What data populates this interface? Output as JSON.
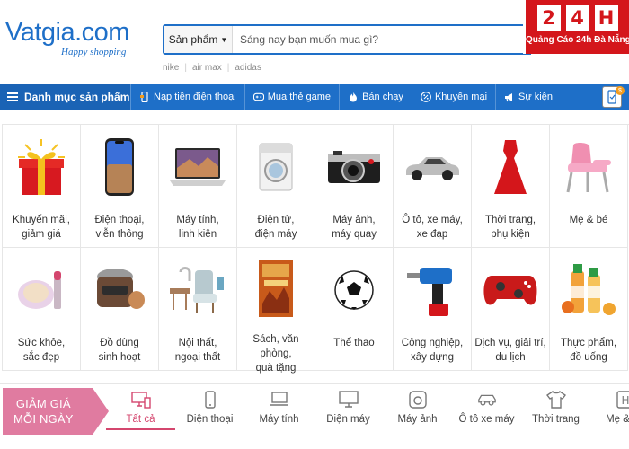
{
  "logo": {
    "name": "Vatgia.com",
    "tagline": "Happy shopping"
  },
  "search": {
    "category": "Sản phẩm",
    "placeholder": "Sáng nay bạn muốn mua gì?"
  },
  "suggest_tags": [
    "nike",
    "air max",
    "adidas"
  ],
  "promo": {
    "boxes": [
      "2",
      "4",
      "H"
    ],
    "text": "Quảng Cáo 24h Đà Nẵng"
  },
  "navbar": {
    "main": "Danh mục sản phẩm",
    "items": [
      {
        "label": "Nạp tiền điện thoại",
        "icon": "phone-topup-icon"
      },
      {
        "label": "Mua thẻ game",
        "icon": "gamepad-icon"
      },
      {
        "label": "Bán chạy",
        "icon": "flame-icon"
      },
      {
        "label": "Khuyến mại",
        "icon": "discount-icon"
      },
      {
        "label": "Sự kiện",
        "icon": "megaphone-icon"
      }
    ]
  },
  "categories": [
    {
      "label": "Khuyến mãi,\ngiảm giá",
      "icon": "gift-box-icon"
    },
    {
      "label": "Điện thoại,\nviễn thông",
      "icon": "smartphone-icon"
    },
    {
      "label": "Máy tính,\nlinh kiện",
      "icon": "laptop-icon"
    },
    {
      "label": "Điện tử,\nđiện máy",
      "icon": "washing-machine-icon"
    },
    {
      "label": "Máy ảnh,\nmáy quay",
      "icon": "camera-icon"
    },
    {
      "label": "Ô tô, xe máy,\nxe đạp",
      "icon": "car-icon"
    },
    {
      "label": "Thời trang,\nphụ kiện",
      "icon": "dress-icon"
    },
    {
      "label": "Mẹ & bé",
      "icon": "baby-chair-icon"
    },
    {
      "label": "Sức khỏe,\nsắc đẹp",
      "icon": "cosmetics-icon"
    },
    {
      "label": "Đồ dùng\nsinh hoạt",
      "icon": "rice-cooker-icon"
    },
    {
      "label": "Nội thất,\nngoại thất",
      "icon": "furniture-icon"
    },
    {
      "label": "Sách, văn phòng,\nquà tặng",
      "icon": "book-icon"
    },
    {
      "label": "Thể thao",
      "icon": "football-icon"
    },
    {
      "label": "Công nghiệp,\nxây dựng",
      "icon": "drill-icon"
    },
    {
      "label": "Dịch vụ, giải trí,\ndu lịch",
      "icon": "game-controller-icon"
    },
    {
      "label": "Thực phẩm,\nđồ uống",
      "icon": "juice-bottles-icon"
    }
  ],
  "deals": {
    "title_line1": "GIẢM GIÁ",
    "title_line2": "MỖI NGÀY",
    "tabs": [
      {
        "label": "Tất cả",
        "icon": "monitor-phone-icon",
        "active": true
      },
      {
        "label": "Điện thoại",
        "icon": "smartphone-icon"
      },
      {
        "label": "Máy tính",
        "icon": "laptop-icon"
      },
      {
        "label": "Điện máy",
        "icon": "tv-icon"
      },
      {
        "label": "Máy ảnh",
        "icon": "camera-icon"
      },
      {
        "label": "Ô tô xe máy",
        "icon": "car-icon"
      },
      {
        "label": "Thời trang",
        "icon": "shirt-icon"
      },
      {
        "label": "Mẹ & bé",
        "icon": "stroller-icon"
      }
    ]
  },
  "colors": {
    "brand_blue": "#1e6fc8",
    "promo_red": "#d4161b",
    "deal_pink": "#e07ba0",
    "active_tab": "#d4466e"
  }
}
